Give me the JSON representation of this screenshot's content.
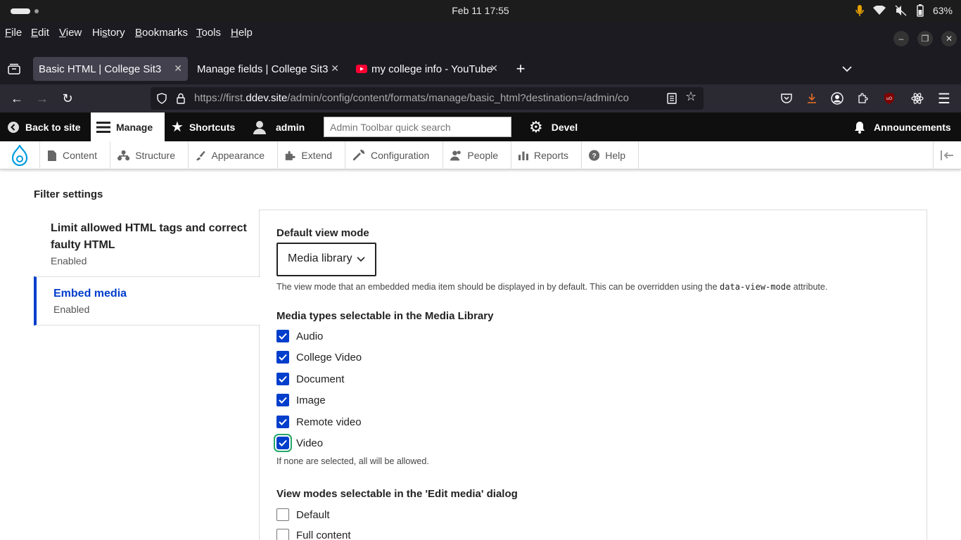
{
  "os": {
    "clock": "Feb 11  17:55",
    "battery": "63%"
  },
  "menubar": {
    "items": [
      {
        "pre": "",
        "u": "F",
        "post": "ile"
      },
      {
        "pre": "",
        "u": "E",
        "post": "dit"
      },
      {
        "pre": "",
        "u": "V",
        "post": "iew"
      },
      {
        "pre": "Hi",
        "u": "s",
        "post": "tory"
      },
      {
        "pre": "",
        "u": "B",
        "post": "ookmarks"
      },
      {
        "pre": "",
        "u": "T",
        "post": "ools"
      },
      {
        "pre": "",
        "u": "H",
        "post": "elp"
      }
    ]
  },
  "tabs": [
    {
      "label": "Basic HTML | College Sit3"
    },
    {
      "label": "Manage fields | College Sit3"
    },
    {
      "label": "my college info - YouTube"
    }
  ],
  "url": {
    "prefix": "https://first.",
    "host": "ddev.site",
    "path": "/admin/config/content/formats/manage/basic_html?destination=/admin/co"
  },
  "toolbar": {
    "back": "Back to site",
    "manage": "Manage",
    "shortcuts": "Shortcuts",
    "user": "admin",
    "search_placeholder": "Admin Toolbar quick search",
    "devel": "Devel",
    "announcements": "Announcements"
  },
  "tray": {
    "items": [
      "Content",
      "Structure",
      "Appearance",
      "Extend",
      "Configuration",
      "People",
      "Reports",
      "Help"
    ]
  },
  "page": {
    "filter_settings": "Filter settings",
    "vtabs": [
      {
        "title": "Limit allowed HTML tags and correct faulty HTML",
        "status": "Enabled"
      },
      {
        "title": "Embed media",
        "status": "Enabled"
      }
    ],
    "default_view_mode_label": "Default view mode",
    "default_view_mode_value": "Media library",
    "view_mode_desc_pre": "The view mode that an embedded media item should be displayed in by default. This can be overridden using the ",
    "view_mode_desc_code": "data-view-mode",
    "view_mode_desc_post": " attribute.",
    "media_types_label": "Media types selectable in the Media Library",
    "media_types": [
      {
        "label": "Audio",
        "checked": true
      },
      {
        "label": "College Video",
        "checked": true
      },
      {
        "label": "Document",
        "checked": true
      },
      {
        "label": "Image",
        "checked": true
      },
      {
        "label": "Remote video",
        "checked": true
      },
      {
        "label": "Video",
        "checked": true
      }
    ],
    "media_types_desc": "If none are selected, all will be allowed.",
    "view_modes_label": "View modes selectable in the 'Edit media' dialog",
    "view_modes": [
      {
        "label": "Default",
        "checked": false
      },
      {
        "label": "Full content",
        "checked": false
      }
    ]
  },
  "colors": {
    "accent": "#003ecc",
    "focus": "#26a769"
  }
}
